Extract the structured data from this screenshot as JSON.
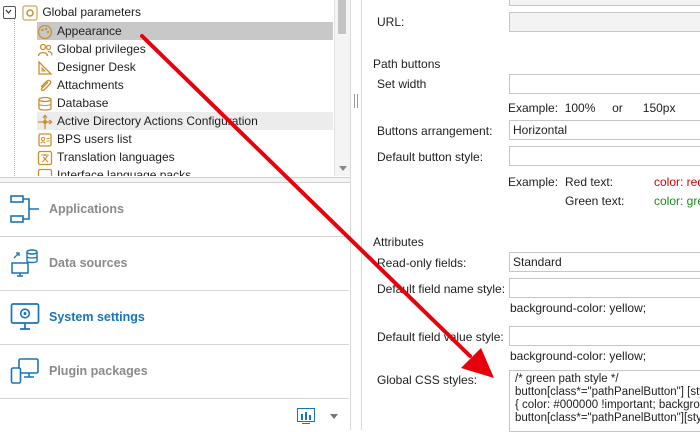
{
  "tree": {
    "root_label": "Global parameters",
    "items": [
      {
        "label": "Appearance",
        "icon": "palette-icon"
      },
      {
        "label": "Global privileges",
        "icon": "users-icon"
      },
      {
        "label": "Designer Desk",
        "icon": "set-square-icon"
      },
      {
        "label": "Attachments",
        "icon": "paperclip-icon"
      },
      {
        "label": "Database",
        "icon": "database-icon"
      },
      {
        "label": "Active Directory Actions Configuration",
        "icon": "active-directory-icon"
      },
      {
        "label": "BPS users list",
        "icon": "users-list-icon"
      },
      {
        "label": "Translation languages",
        "icon": "translation-icon"
      },
      {
        "label": "Interface language packs",
        "icon": "language-pack-icon"
      }
    ]
  },
  "nav": {
    "applications": "Applications",
    "data_sources": "Data sources",
    "system_settings": "System settings",
    "plugin_packages": "Plugin packages"
  },
  "form": {
    "url_label": "URL:",
    "path_buttons_section": "Path buttons",
    "set_width_label": "Set width",
    "set_width_value": "",
    "width_example": {
      "prefix": "Example:",
      "v1": "100%",
      "or": "or",
      "v2": "150px"
    },
    "buttons_arrangement_label": "Buttons arrangement:",
    "buttons_arrangement_value": "Horizontal",
    "default_button_style_label": "Default button style:",
    "style_example": {
      "prefix": "Example:",
      "red_label": "Red text:",
      "red_code": "color: red",
      "green_label": "Green text:",
      "green_code": "color: gre"
    },
    "attributes_section": "Attributes",
    "readonly_fields_label": "Read-only fields:",
    "readonly_fields_value": "Standard",
    "default_field_name_style_label": "Default field name style:",
    "field_name_hint": "background-color: yellow;",
    "default_field_value_style_label": "Default field value style:",
    "field_value_hint": "background-color: yellow;",
    "global_css_label": "Global CSS styles:",
    "global_css_lines": [
      "/* green path style */",
      "button[class*=\"pathPanelButton\"] [sty",
      "{ color: #000000 !important; backgrou",
      "button[class*=\"pathPanelButton\"][styl"
    ]
  },
  "colors": {
    "accent": "#1a74b8",
    "arrow": "#e8000b",
    "selected_row": "#c8c8c8",
    "example_red": "#d40000",
    "example_green": "#1a8a1a"
  }
}
